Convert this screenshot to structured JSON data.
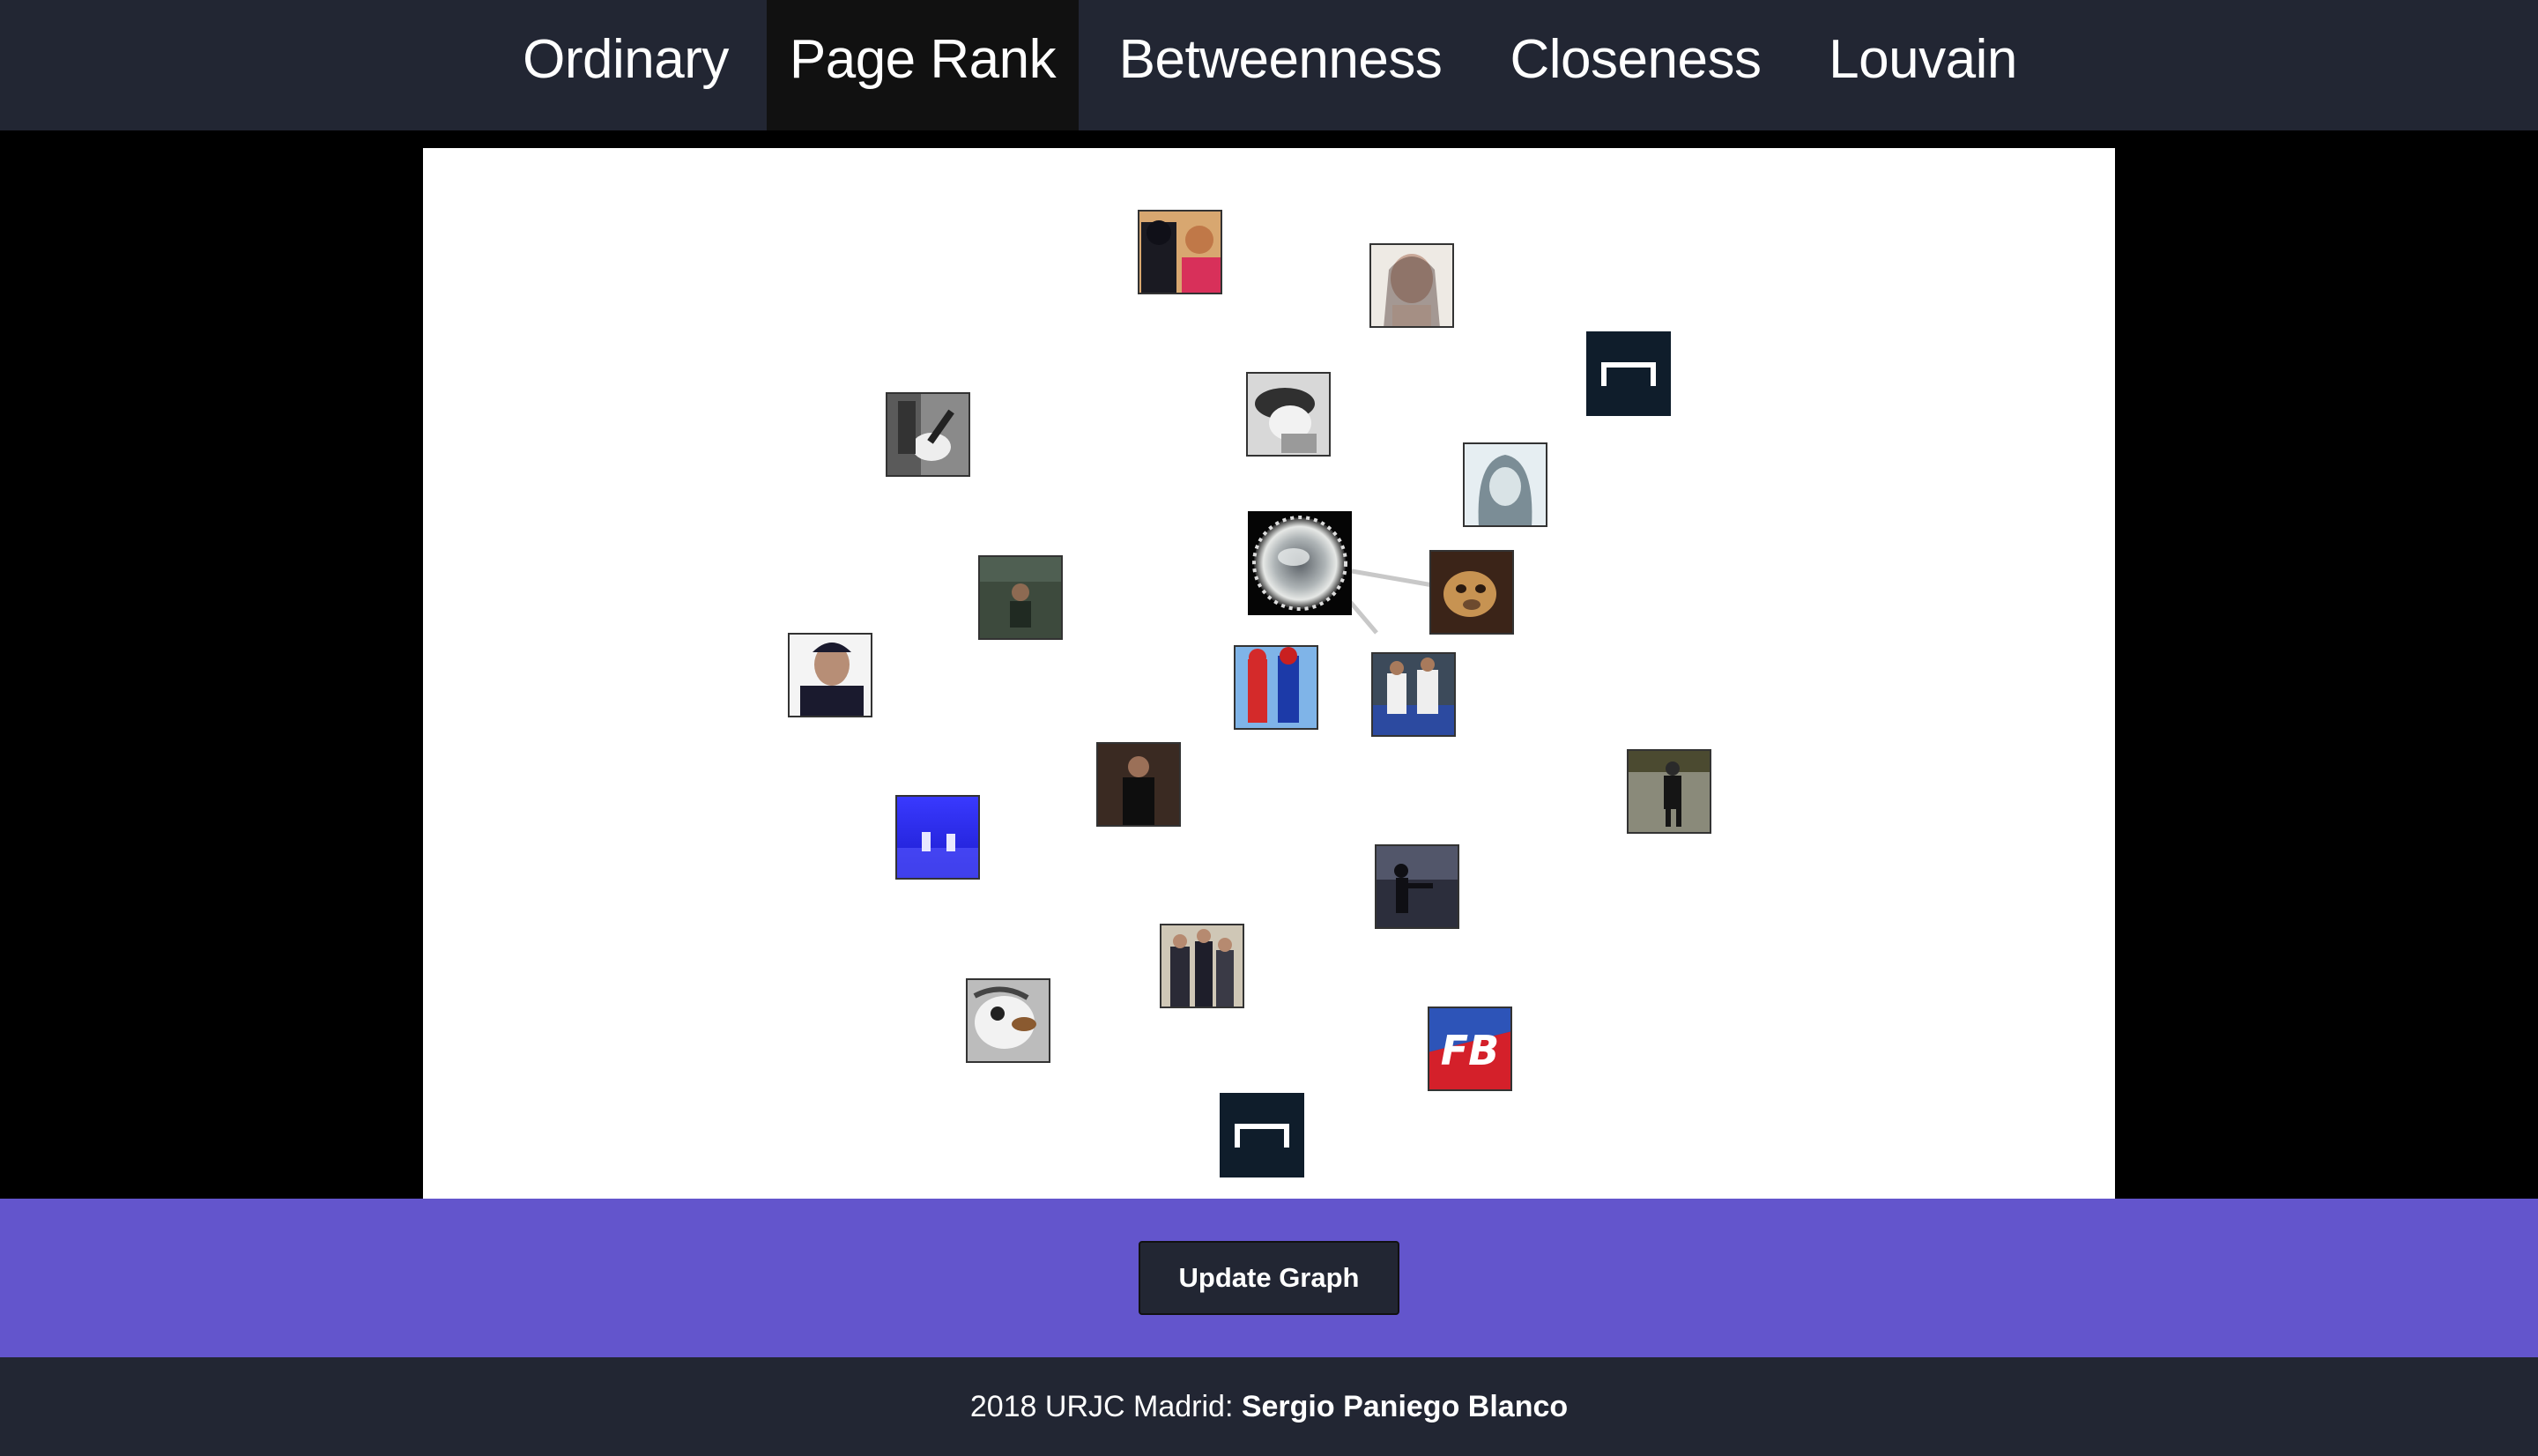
{
  "nav": {
    "tabs": [
      {
        "label": "Ordinary",
        "active": false
      },
      {
        "label": "Page Rank",
        "active": true
      },
      {
        "label": "Betweenness",
        "active": false
      },
      {
        "label": "Closeness",
        "active": false
      },
      {
        "label": "Louvain",
        "active": false
      }
    ]
  },
  "graph": {
    "node_images": [
      "couple-photo",
      "woman-portrait",
      "brand-logo-dark",
      "guitar-photo",
      "sleeping-person-bw",
      "hijab-woman-portrait",
      "person-sitting-photo",
      "crystal-ball-photo",
      "dog-photo",
      "man-cap-portrait",
      "superhero-cosplay",
      "football-players",
      "person-walking-photo",
      "man-black-shirt",
      "blue-stage-photo",
      "silhouette-sunset",
      "group-formal-photo",
      "cartoon-bird",
      "fb-logo",
      "brand-logo-dark"
    ],
    "logo_text": "FB"
  },
  "actions": {
    "update_label": "Update Graph"
  },
  "footer": {
    "prefix": "2018 URJC Madrid: ",
    "author": "Sergio Paniego Blanco"
  },
  "colors": {
    "navbar": "#222633",
    "active_tab": "#111111",
    "action_bar": "#6355CC",
    "canvas": "#ffffff",
    "edge": "#c8c8c8"
  }
}
